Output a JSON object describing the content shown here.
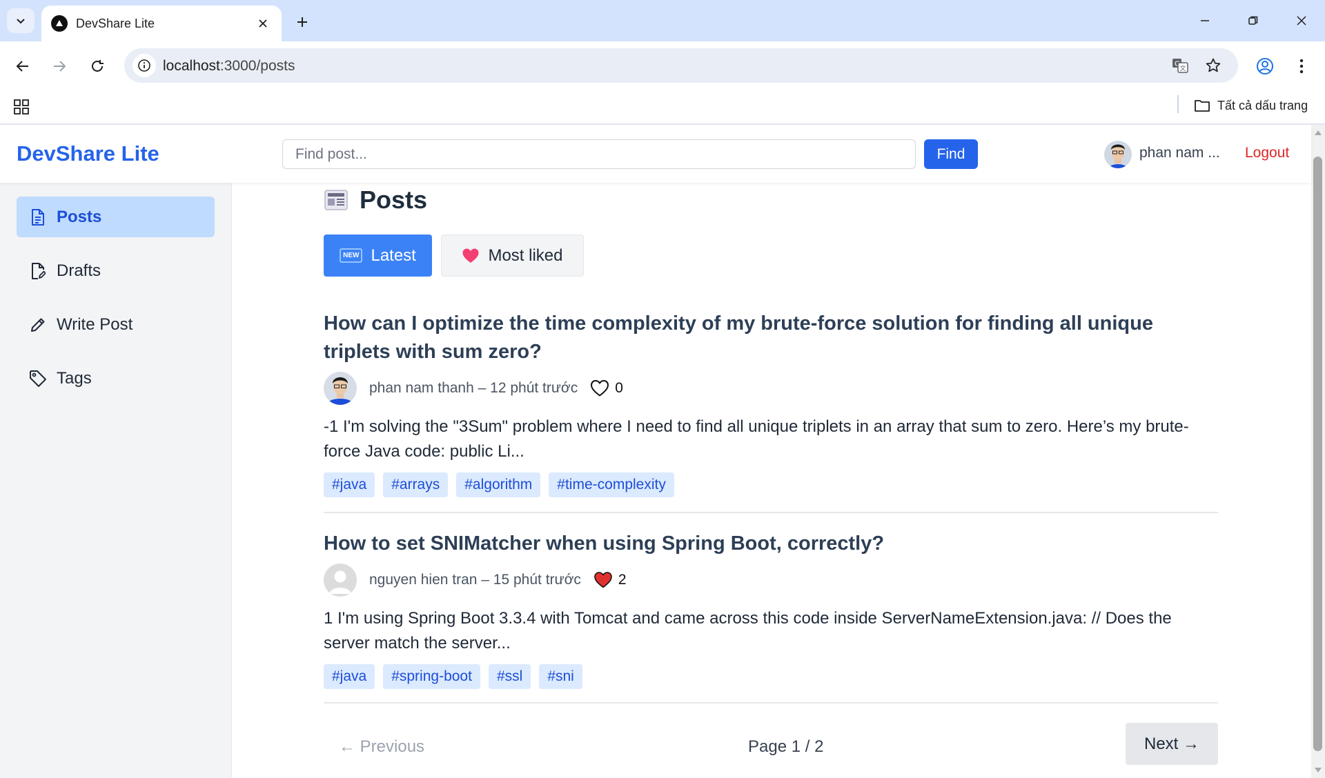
{
  "browser": {
    "tab_title": "DevShare Lite",
    "url_host": "localhost",
    "url_path": ":3000/posts",
    "bookmarks_all": "Tất cả dấu trang"
  },
  "header": {
    "brand": "DevShare Lite",
    "search_placeholder": "Find post...",
    "search_value": "",
    "find_label": "Find",
    "user_name": "phan nam ...",
    "logout_label": "Logout"
  },
  "sidebar": {
    "items": [
      {
        "label": "Posts",
        "icon": "document-icon",
        "active": true
      },
      {
        "label": "Drafts",
        "icon": "draft-icon",
        "active": false
      },
      {
        "label": "Write Post",
        "icon": "pencil-icon",
        "active": false
      },
      {
        "label": "Tags",
        "icon": "tag-icon",
        "active": false
      }
    ]
  },
  "main": {
    "title": "Posts",
    "title_icon": "newspaper-icon",
    "sort": {
      "latest_badge": "NEW",
      "latest_label": "Latest",
      "liked_label": "Most liked",
      "active": "latest"
    },
    "posts": [
      {
        "title": "How can I optimize the time complexity of my brute-force solution for finding all unique triplets with sum zero?",
        "meta": "phan nam thanh – 12 phút trước",
        "likes": "0",
        "liked": false,
        "excerpt": "-1 I'm solving the \"3Sum\" problem where I need to find all unique triplets in an array that sum to zero. Here’s my brute-force Java code: public Li...",
        "tags": [
          "#java",
          "#arrays",
          "#algorithm",
          "#time-complexity"
        ]
      },
      {
        "title": "How to set SNIMatcher when using Spring Boot, correctly?",
        "meta": "nguyen hien tran – 15 phút trước",
        "likes": "2",
        "liked": true,
        "excerpt": "1 I'm using Spring Boot 3.3.4 with Tomcat and came across this code inside ServerNameExtension.java: // Does the server match the server...",
        "tags": [
          "#java",
          "#spring-boot",
          "#ssl",
          "#sni"
        ]
      }
    ],
    "pagination": {
      "prev_label": "← Previous",
      "info": "Page 1 / 2",
      "next_label": "Next →"
    }
  },
  "colors": {
    "brand": "#2563eb",
    "logout": "#dc2626",
    "active_nav_bg": "#bfdbfe",
    "tag_bg": "#dbeafe",
    "like_red": "#e03131"
  }
}
